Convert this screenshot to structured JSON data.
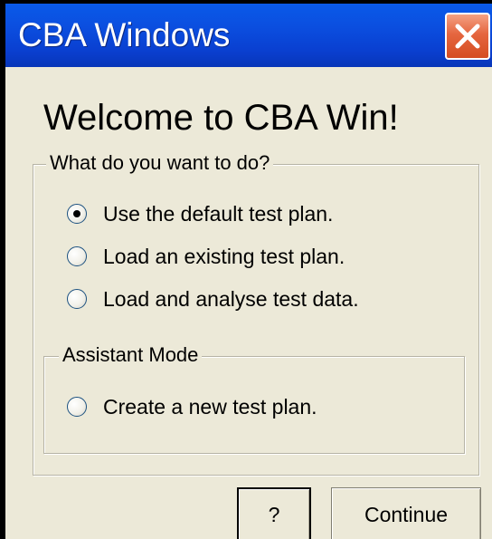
{
  "window": {
    "title": "CBA Windows",
    "close_icon": "close-x-icon"
  },
  "welcome_heading": "Welcome to CBA Win!",
  "main_group": {
    "legend": "What do you want to do?",
    "options": [
      {
        "label": "Use the default test plan.",
        "checked": true
      },
      {
        "label": "Load an existing test plan.",
        "checked": false
      },
      {
        "label": "Load and analyse test data.",
        "checked": false
      }
    ]
  },
  "assistant_group": {
    "legend": "Assistant Mode",
    "options": [
      {
        "label": "Create a new test plan.",
        "checked": false
      }
    ]
  },
  "buttons": {
    "help_label": "?",
    "continue_label": "Continue"
  },
  "colors": {
    "titlebar": "#0a4fe0",
    "close_button": "#e5663f",
    "dialog_background": "#ece9d8"
  }
}
